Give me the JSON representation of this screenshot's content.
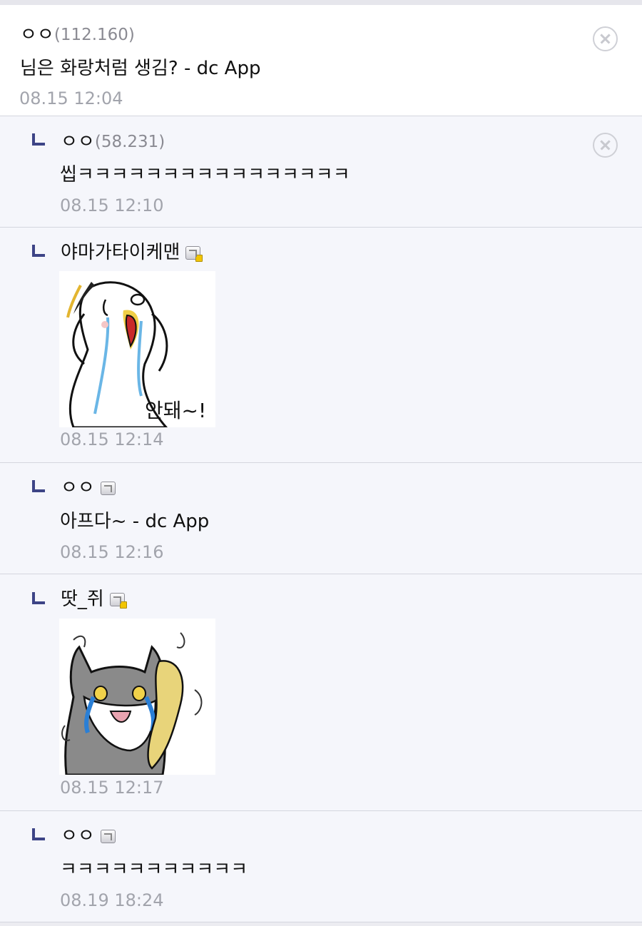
{
  "comments": [
    {
      "author": "ㅇㅇ",
      "ip": "(112.160)",
      "text": "님은 화랑처럼 생김? - dc App",
      "time": "08.15 12:04"
    },
    {
      "author": "ㅇㅇ",
      "ip": "(58.231)",
      "text": "씹ㅋㅋㅋㅋㅋㅋㅋㅋㅋㅋㅋㅋㅋㅋㅋㅋ",
      "time": "08.15 12:10"
    },
    {
      "author": "야마가타이케맨",
      "sticker_text": "안돼~!",
      "time": "08.15 12:14"
    },
    {
      "author": "ㅇㅇ",
      "text": "아프다~ - dc App",
      "time": "08.15 12:16"
    },
    {
      "author": "땃_쥐",
      "time": "08.15 12:17"
    },
    {
      "author": "ㅇㅇ",
      "text": "ㅋㅋㅋㅋㅋㅋㅋㅋㅋㅋㅋ",
      "time": "08.19 18:24"
    }
  ],
  "colors": {
    "accent": "#3d4486",
    "time": "#a2a4ac",
    "divider": "#d4d6de",
    "reply_bg": "#f5f6fb"
  },
  "icons": {
    "delete": "close-circle-icon",
    "reply": "reply-arrow-icon",
    "member": "gallog-badge-icon"
  }
}
